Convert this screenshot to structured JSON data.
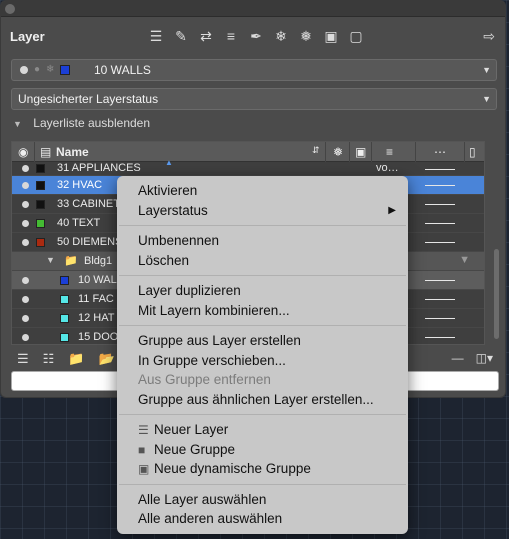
{
  "panel": {
    "title": "Layer",
    "tool_icons": [
      "layer-stack-icon",
      "layer-edit-icon",
      "layer-merge-icon",
      "layer-list-icon",
      "layer-pen-icon",
      "layer-freeze-icon",
      "layer-snow-icon",
      "layer-lock-icon",
      "layer-unlock-icon"
    ]
  },
  "current_layer": {
    "name": "10 WALLS",
    "color": "#1b3fd6"
  },
  "layer_state": {
    "value": "Ungesicherter Layerstatus"
  },
  "collapse_label": "Layerliste ausblenden",
  "table": {
    "header_name": "Name",
    "rows": [
      {
        "name": "31 APPLIANCES",
        "color": "#111111",
        "extra": "vo…",
        "kind": "partial"
      },
      {
        "name": "32 HVAC",
        "color": "#111111",
        "kind": "selected"
      },
      {
        "name": "33 CABINET",
        "color": "#111111",
        "kind": "normal"
      },
      {
        "name": "40 TEXT",
        "color": "#44bb33",
        "kind": "normal"
      },
      {
        "name": "50 DIEMENS",
        "color": "#aa2a10",
        "kind": "normal"
      },
      {
        "name": "Bldg1",
        "kind": "group"
      },
      {
        "name": "10 WAL",
        "color": "#1b3fd6",
        "kind": "sub-current"
      },
      {
        "name": "11 FAC",
        "color": "#55e6e6",
        "kind": "sub"
      },
      {
        "name": "12 HAT",
        "color": "#55e6e6",
        "kind": "sub"
      },
      {
        "name": "15 DOO",
        "color": "#55e6e6",
        "kind": "sub"
      }
    ]
  },
  "context_menu": {
    "activate": "Aktivieren",
    "layer_state": "Layerstatus",
    "rename": "Umbenennen",
    "delete": "Löschen",
    "duplicate": "Layer duplizieren",
    "merge": "Mit Layern kombinieren...",
    "group_from_layer": "Gruppe aus Layer erstellen",
    "move_to_group": "In Gruppe verschieben...",
    "remove_from_group": "Aus Gruppe entfernen",
    "group_from_similar": "Gruppe aus ähnlichen Layer erstellen...",
    "new_layer": "Neuer Layer",
    "new_group": "Neue Gruppe",
    "new_dynamic_group": "Neue dynamische Gruppe",
    "select_all": "Alle Layer auswählen",
    "select_others": "Alle anderen auswählen"
  }
}
